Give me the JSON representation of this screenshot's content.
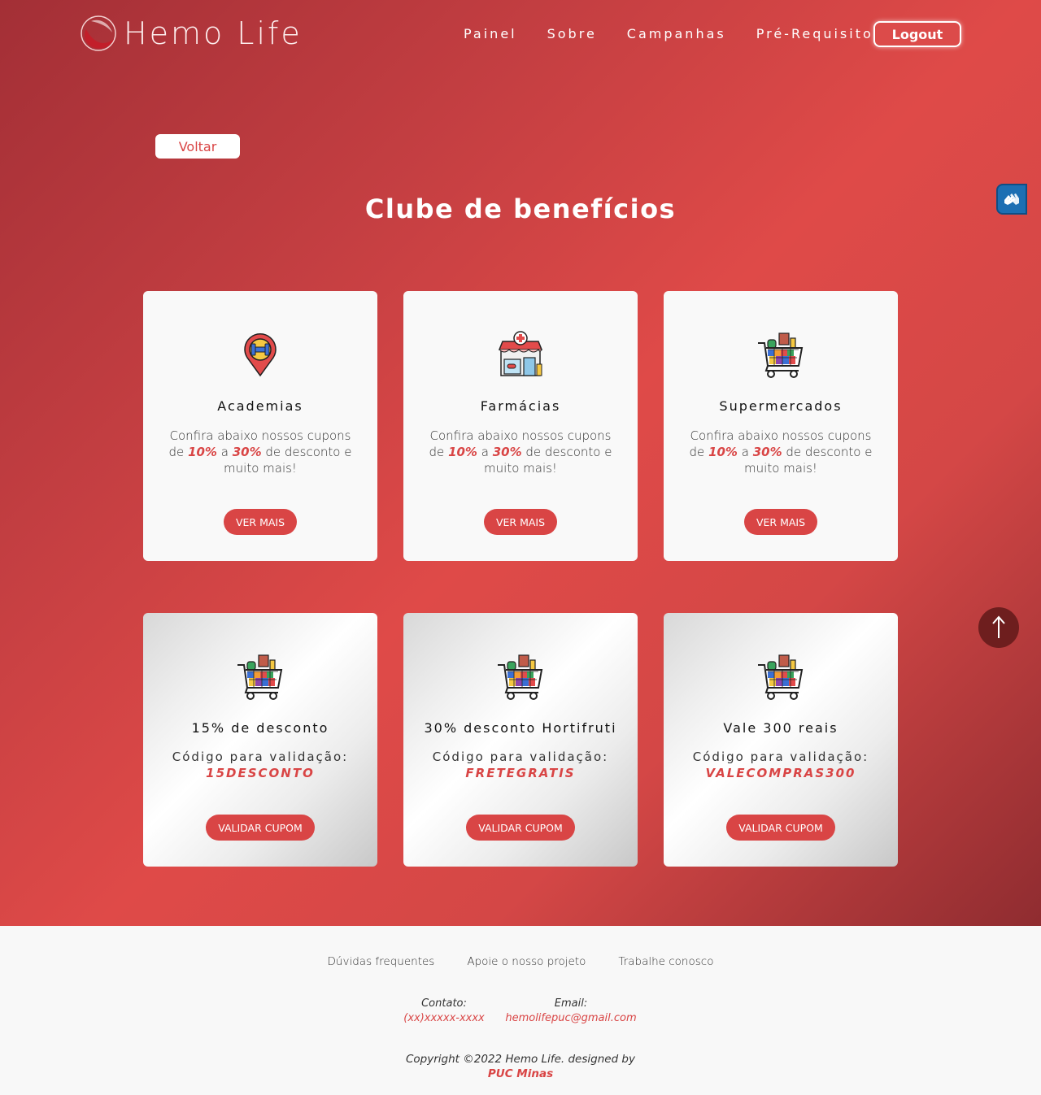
{
  "header": {
    "logo_text": "Hemo Life",
    "nav": [
      "Painel",
      "Sobre",
      "Campanhas",
      "Pré-Requisitos"
    ],
    "logout_label": "Logout"
  },
  "back_label": "Voltar",
  "page_title": "Clube de benefícios",
  "category_cards": [
    {
      "icon": "gym-location-icon",
      "title": "Academias",
      "desc_prefix": "Confira abaixo nossos cupons de ",
      "desc_low": "10%",
      "desc_mid": " a ",
      "desc_high": "30%",
      "desc_suffix": " de desconto e muito mais!",
      "button": "VER MAIS"
    },
    {
      "icon": "pharmacy-icon",
      "title": "Farmácias",
      "desc_prefix": "Confira abaixo nossos cupons de ",
      "desc_low": "10%",
      "desc_mid": " a ",
      "desc_high": "30%",
      "desc_suffix": " de desconto e muito mais!",
      "button": "VER MAIS"
    },
    {
      "icon": "shopping-cart-icon",
      "title": "Supermercados",
      "desc_prefix": "Confira abaixo nossos cupons de ",
      "desc_low": "10%",
      "desc_mid": " a ",
      "desc_high": "30%",
      "desc_suffix": " de desconto e muito mais!",
      "button": "VER MAIS"
    }
  ],
  "coupon_cards": [
    {
      "icon": "shopping-cart-icon",
      "title": "15% de desconto",
      "code_label": "Código para validação:",
      "code": "15DESCONTO",
      "button": "VALIDAR CUPOM"
    },
    {
      "icon": "shopping-cart-icon",
      "title": "30% desconto Hortifruti",
      "code_label": "Código para validação:",
      "code": "FRETEGRATIS",
      "button": "VALIDAR CUPOM"
    },
    {
      "icon": "shopping-cart-icon",
      "title": "Vale 300 reais",
      "code_label": "Código para validação:",
      "code": "VALECOMPRAS300",
      "button": "VALIDAR CUPOM"
    }
  ],
  "footer": {
    "links": [
      "Dúvidas frequentes",
      "Apoie o nosso projeto",
      "Trabalhe conosco"
    ],
    "contact_label": "Contato:",
    "contact_value": "(xx)xxxxx-xxxx",
    "email_label": "Email:",
    "email_value": "hemolifepuc@gmail.com",
    "copyright": "Copyright ©2022 Hemo Life. designed by",
    "designer": "PUC Minas"
  },
  "colors": {
    "accent": "#d94545",
    "hero_start": "#a32f36",
    "hero_mid": "#df4a48",
    "hero_end": "#8f2c30"
  }
}
